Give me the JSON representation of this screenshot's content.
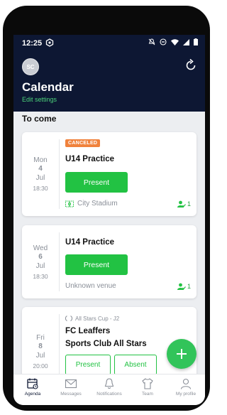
{
  "status_bar": {
    "time": "12:25"
  },
  "header": {
    "avatar_initials": "SC",
    "title": "Calendar",
    "edit_link": "Edit settings"
  },
  "section_title": "To come",
  "events": [
    {
      "dow": "Mon",
      "day": "4",
      "month": "Jul",
      "time": "18:30",
      "badge": "CANCELED",
      "title": "U14 Practice",
      "button": "Present",
      "venue": "City Stadium",
      "count": "1"
    },
    {
      "dow": "Wed",
      "day": "6",
      "month": "Jul",
      "time": "18:30",
      "title": "U14 Practice",
      "button": "Present",
      "venue": "Unknown venue",
      "count": "1"
    },
    {
      "dow": "Fri",
      "day": "8",
      "month": "Jul",
      "time": "20:00",
      "league": "All Stars Cup - J2",
      "home_team": "FC Leaffers",
      "away_team": "Sports Club All Stars",
      "present_label": "Present",
      "absent_label": "Absent"
    }
  ],
  "bottom_nav": [
    {
      "label": "Agenda",
      "icon": "calendar-icon",
      "active": true
    },
    {
      "label": "Messages",
      "icon": "envelope-icon"
    },
    {
      "label": "Notifications",
      "icon": "bell-icon"
    },
    {
      "label": "Team",
      "icon": "shirt-icon"
    },
    {
      "label": "My profile",
      "icon": "user-icon"
    }
  ],
  "colors": {
    "header_bg": "#0d1733",
    "accent_green": "#22c243",
    "link_green": "#4cd37b",
    "badge_orange": "#f0823c"
  }
}
